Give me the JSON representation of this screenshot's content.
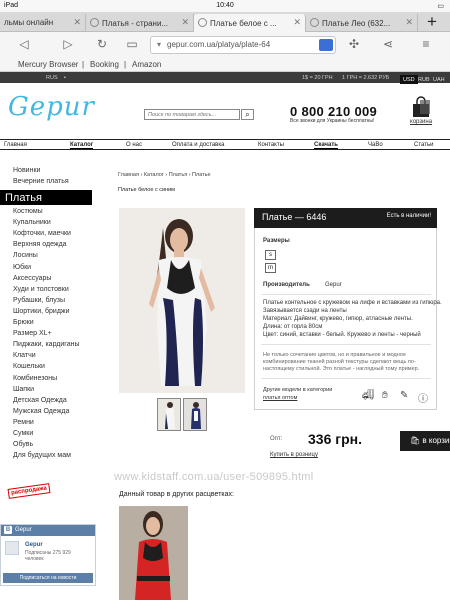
{
  "status_bar": {
    "device": "iPad",
    "time": "10:40",
    "battery": "▬"
  },
  "tabs": [
    {
      "label": "льмы онлайн",
      "active": false
    },
    {
      "label": "Платья - страни...",
      "active": false
    },
    {
      "label": "Платье белое с ...",
      "active": true
    },
    {
      "label": "Платье Лео (632...",
      "active": false
    }
  ],
  "address": {
    "url": "gepur.com.ua/platya/plate-64"
  },
  "bookmarks": [
    "Mercury Browser",
    "Booking",
    "Amazon"
  ],
  "top_strip": {
    "lang": "RUS",
    "rate1": "1$ = 20 ГРН",
    "rate2": "1 ГРН = 2.632 РУБ",
    "currencies": [
      "USD",
      "RUB",
      "UAH"
    ]
  },
  "header": {
    "logo": "Gepur",
    "search_placeholder": "Поиск по товарам здесь...",
    "phone": "0 800 210 009",
    "phone_note": "Все звонки для Украины бесплатны!",
    "cart_label": "корзина"
  },
  "menu": [
    "Главная",
    "Каталог",
    "О нас",
    "Оплата и доставка",
    "Контакты",
    "Скачать",
    "ЧаВо",
    "Статьи"
  ],
  "sidebar": {
    "top_items": [
      "Новинки",
      "Вечерние платья"
    ],
    "active": "Платья",
    "items": [
      "Костюмы",
      "Купальники",
      "Кофточки, маечки",
      "Верхняя одежда",
      "Лосины",
      "Юбки",
      "Аксессуары",
      "Худи и толстовки",
      "Рубашки, блузы",
      "Шортики, бриджи",
      "Брюки",
      "Размер XL+",
      "Пиджаки, кардиганы",
      "Клатчи",
      "Кошельки",
      "Комбинезоны",
      "Шапки",
      "Детская Одежда",
      "Мужская Одежда",
      "Ремни",
      "Сумки",
      "Обувь",
      "Для будущих мам"
    ],
    "promo": "распродажа"
  },
  "vk": {
    "title": "Gepur",
    "name": "Gepur",
    "subscribers": "Подписаны 275 929 человек",
    "join": "Подписаться на новости"
  },
  "product": {
    "breadcrumb": "Главная › Каталог › Платья › Платье",
    "subtitle": "Платье белое с синим",
    "title": "Платье — 6446",
    "stock": "Есть в наличии!",
    "sizes_label": "Размеры",
    "sizes": [
      "s",
      "m"
    ],
    "manufacturer_label": "Производитель",
    "manufacturer": "Gepur",
    "desc": [
      "Платье контельное с кружевом на лифе и вставками из гипюра.",
      "Завязывается сзади на ленты",
      "Материал: Дайвинг, кружево, гипюр, атласные ленты.",
      "Длина: от горла 80см",
      "Цвет: синий, вставки - белый. Кружево и ленты - черный"
    ],
    "note": [
      "Не только сочетание цветов, но и правильное и модное",
      "комбинирование тканей разной текстуры сделают вещь по-",
      "настоящему стильной. Это платье - наглядный тому пример."
    ],
    "similar_label": "Другие модели в категории",
    "similar_link": "платья оптом",
    "old_price_label": "Опт:",
    "price": "336 грн.",
    "one_click": "Купить в розницу",
    "cart_button": "в корзину"
  },
  "watermark": "www.kidstaff.com.ua/user-509895.html",
  "other_colors": "Данный товар в других расцветках:",
  "colors": {
    "accent": "#40b8e0",
    "dark": "#1c1c1c",
    "vk": "#5b7fa6",
    "sale": "#d40000"
  }
}
